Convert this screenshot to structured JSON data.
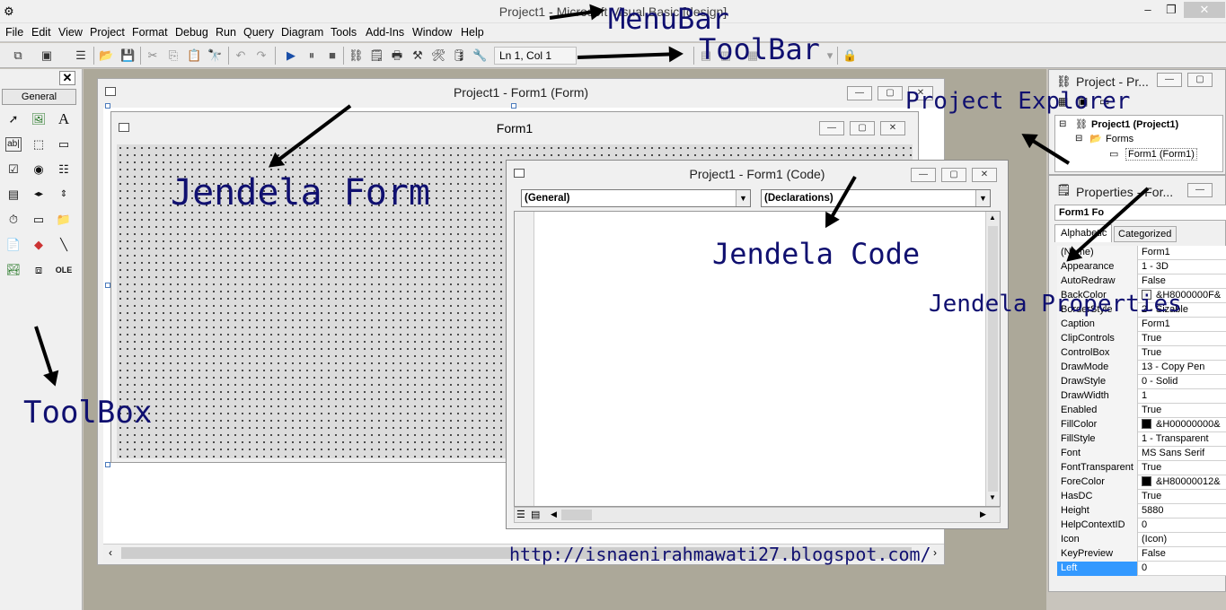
{
  "window": {
    "title": "Project1 - Microsoft Visual Basic [design]",
    "min": "‒",
    "max": "❐",
    "close": "✕"
  },
  "menu": [
    "File",
    "Edit",
    "View",
    "Project",
    "Format",
    "Debug",
    "Run",
    "Query",
    "Diagram",
    "Tools",
    "Add-Ins",
    "Window",
    "Help"
  ],
  "toolbar": {
    "position": "Ln 1, Col 1"
  },
  "toolbox": {
    "close": "✕",
    "tab": "General",
    "tools": [
      "pointer-icon",
      "picturebox-icon",
      "label-icon",
      "textbox-icon",
      "frame-icon",
      "commandbutton-icon",
      "checkbox-icon",
      "optionbutton-icon",
      "combobox-icon",
      "listbox-icon",
      "hscrollbar-icon",
      "vscrollbar-icon",
      "timer-icon",
      "drivelistbox-icon",
      "dirlistbox-icon",
      "filelistbox-icon",
      "shape-icon",
      "line-icon",
      "image-icon",
      "data-icon",
      "ole-icon"
    ]
  },
  "form_window": {
    "title": "Project1 - Form1 (Form)",
    "form_caption": "Form1"
  },
  "code_window": {
    "title": "Project1 - Form1 (Code)",
    "object_combo": "(General)",
    "proc_combo": "(Declarations)"
  },
  "project_explorer": {
    "title": "Project - Pr...",
    "root": "Project1 (Project1)",
    "folder": "Forms",
    "item": "Form1 (Form1)"
  },
  "properties": {
    "title": "Properties - For...",
    "object": "Form1 Fo",
    "tabs": [
      "Alphabetic",
      "Categorized"
    ],
    "rows": [
      {
        "name": "(Name)",
        "value": "Form1"
      },
      {
        "name": "Appearance",
        "value": "1 - 3D"
      },
      {
        "name": "AutoRedraw",
        "value": "False"
      },
      {
        "name": "BackColor",
        "value": "&H8000000F&",
        "swatch": "#f0f0f0"
      },
      {
        "name": "BorderStyle",
        "value": "2 - Sizable"
      },
      {
        "name": "Caption",
        "value": "Form1"
      },
      {
        "name": "ClipControls",
        "value": "True"
      },
      {
        "name": "ControlBox",
        "value": "True"
      },
      {
        "name": "DrawMode",
        "value": "13 - Copy Pen"
      },
      {
        "name": "DrawStyle",
        "value": "0 - Solid"
      },
      {
        "name": "DrawWidth",
        "value": "1"
      },
      {
        "name": "Enabled",
        "value": "True"
      },
      {
        "name": "FillColor",
        "value": "&H00000000&",
        "swatch": "#000000"
      },
      {
        "name": "FillStyle",
        "value": "1 - Transparent"
      },
      {
        "name": "Font",
        "value": "MS Sans Serif"
      },
      {
        "name": "FontTransparent",
        "value": "True"
      },
      {
        "name": "ForeColor",
        "value": "&H80000012&",
        "swatch": "#000000"
      },
      {
        "name": "HasDC",
        "value": "True"
      },
      {
        "name": "Height",
        "value": "5880"
      },
      {
        "name": "HelpContextID",
        "value": "0"
      },
      {
        "name": "Icon",
        "value": "(Icon)"
      },
      {
        "name": "KeyPreview",
        "value": "False"
      },
      {
        "name": "Left",
        "value": "0",
        "selected": true
      }
    ]
  },
  "annotations": {
    "menubar": "MenuBar",
    "toolbar": "ToolBar",
    "form": "Jendela Form",
    "code": "Jendela Code",
    "explorer": "Project Explorer",
    "properties": "Jendela Properties",
    "toolbox": "ToolBox",
    "url": "http://isnaenirahmawati27.blogspot.com/"
  }
}
